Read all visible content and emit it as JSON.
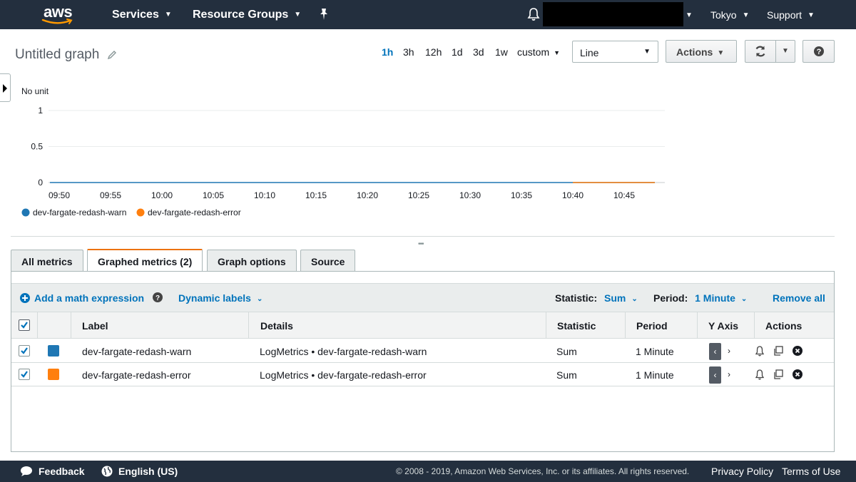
{
  "nav": {
    "logo": "aws",
    "services": "Services",
    "resource_groups": "Resource Groups",
    "region": "Tokyo",
    "support": "Support"
  },
  "graph": {
    "title": "Untitled graph",
    "ranges": [
      "1h",
      "3h",
      "12h",
      "1d",
      "3d",
      "1w"
    ],
    "custom": "custom",
    "view_type": "Line",
    "actions": "Actions"
  },
  "chart_data": {
    "type": "line",
    "ylabel": "No unit",
    "yticks": [
      "1",
      "0.5",
      "0"
    ],
    "ylim": [
      0,
      1
    ],
    "x": [
      "09:50",
      "09:55",
      "10:00",
      "10:05",
      "10:10",
      "10:15",
      "10:20",
      "10:25",
      "10:30",
      "10:35",
      "10:40",
      "10:45"
    ],
    "series": [
      {
        "name": "dev-fargate-redash-warn",
        "color": "#1f77b4",
        "values": [
          0,
          0,
          0,
          0,
          0,
          0,
          0,
          0,
          0,
          0,
          0,
          0
        ]
      },
      {
        "name": "dev-fargate-redash-error",
        "color": "#ff7f0e",
        "values": [
          null,
          null,
          null,
          null,
          null,
          null,
          null,
          null,
          null,
          null,
          0,
          0
        ]
      }
    ],
    "grid": true,
    "legend": "bottom-left"
  },
  "tabs": [
    "All metrics",
    "Graphed metrics (2)",
    "Graph options",
    "Source"
  ],
  "toolbar": {
    "add_math": "Add a math expression",
    "dynamic_labels": "Dynamic labels",
    "statistic_label": "Statistic:",
    "statistic_value": "Sum",
    "period_label": "Period:",
    "period_value": "1 Minute",
    "remove_all": "Remove all"
  },
  "table": {
    "headers": [
      "Label",
      "Details",
      "Statistic",
      "Period",
      "Y Axis",
      "Actions"
    ],
    "rows": [
      {
        "label": "dev-fargate-redash-warn",
        "details": "LogMetrics • dev-fargate-redash-warn",
        "statistic": "Sum",
        "period": "1 Minute",
        "color": "#1f77b4"
      },
      {
        "label": "dev-fargate-redash-error",
        "details": "LogMetrics • dev-fargate-redash-error",
        "statistic": "Sum",
        "period": "1 Minute",
        "color": "#ff7f0e"
      }
    ]
  },
  "footer": {
    "feedback": "Feedback",
    "language": "English (US)",
    "copyright": "© 2008 - 2019, Amazon Web Services, Inc. or its affiliates. All rights reserved.",
    "privacy": "Privacy Policy",
    "terms": "Terms of Use"
  }
}
